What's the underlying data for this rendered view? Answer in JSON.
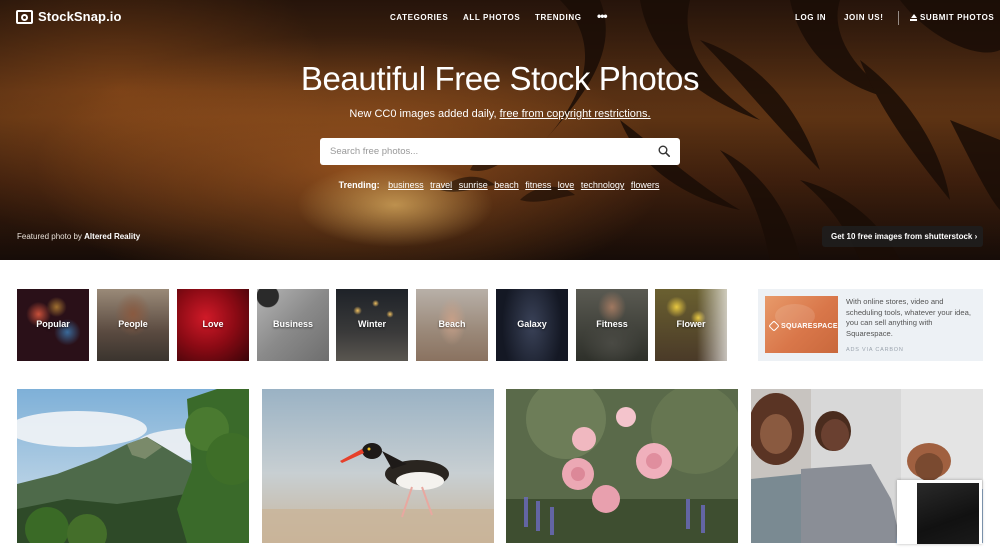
{
  "brand": {
    "name": "StockSnap.io"
  },
  "nav": {
    "categories": "CATEGORIES",
    "all_photos": "ALL PHOTOS",
    "trending": "TRENDING",
    "more": "•••",
    "login": "LOG IN",
    "join": "JOIN US!",
    "submit": "SUBMIT PHOTOS"
  },
  "hero": {
    "title": "Beautiful Free Stock Photos",
    "subtitle_prefix": "New CC0 images added daily, ",
    "subtitle_link": "free from copyright restrictions.",
    "search_placeholder": "Search free photos...",
    "trending_label": "Trending:",
    "trending": [
      "business",
      "travel",
      "sunrise",
      "beach",
      "fitness",
      "love",
      "technology",
      "flowers"
    ],
    "credit_prefix": "Featured photo by ",
    "credit_author": "Altered Reality",
    "shutterstock_button": "Get 10 free images from shutterstock ›"
  },
  "categories": [
    {
      "label": "Popular",
      "color": "#3a1520"
    },
    {
      "label": "People",
      "color": "#6b5a4a"
    },
    {
      "label": "Love",
      "color": "#8a0f1a"
    },
    {
      "label": "Business",
      "color": "#9a9a9a"
    },
    {
      "label": "Winter",
      "color": "#2b2f36"
    },
    {
      "label": "Beach",
      "color": "#a89684"
    },
    {
      "label": "Galaxy",
      "color": "#1d2230"
    },
    {
      "label": "Fitness",
      "color": "#3c3e38"
    },
    {
      "label": "Flower",
      "color": "#7a6a3a"
    }
  ],
  "ad": {
    "brand": "SQUARESPACE",
    "text": "With online stores, video and scheduling tools, whatever your idea, you can sell anything with Squarespace.",
    "via": "ADS VIA CARBON"
  },
  "photos": [
    {
      "subject": "mountain-landscape"
    },
    {
      "subject": "oystercatcher-bird"
    },
    {
      "subject": "pink-roses"
    },
    {
      "subject": "family-on-couch"
    }
  ]
}
